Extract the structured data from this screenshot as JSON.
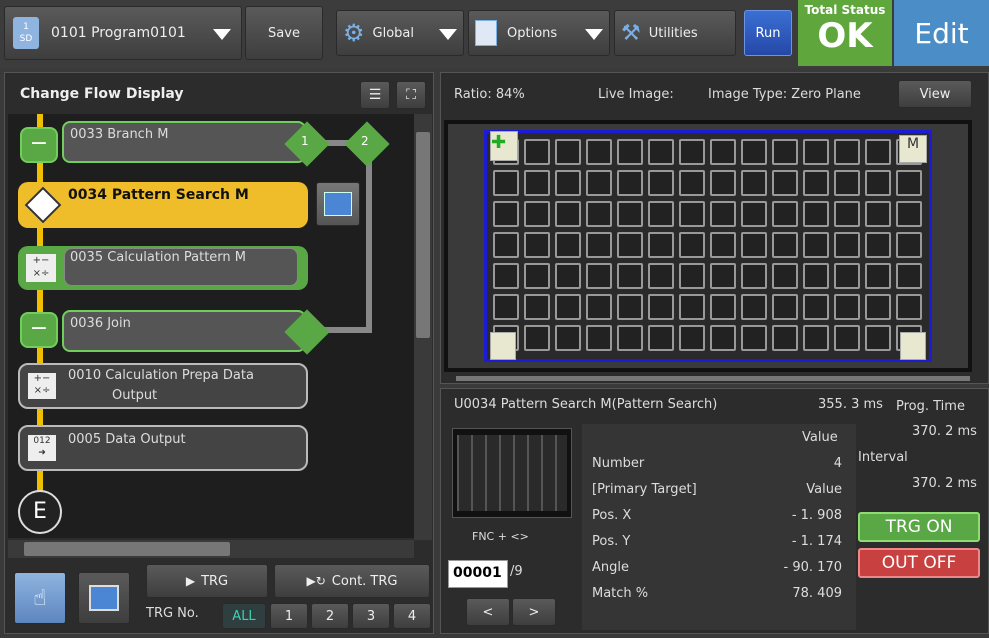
{
  "toolbar": {
    "program": "0101 Program0101",
    "sd_label": "SD",
    "sd_num": "1",
    "save": "Save",
    "global": "Global",
    "options": "Options",
    "utilities": "Utilities",
    "run": "Run",
    "total_status_label": "Total Status",
    "total_status_value": "OK",
    "edit": "Edit"
  },
  "flow": {
    "title": "Change Flow Display",
    "nodes": [
      {
        "label": "0033 Branch  M"
      },
      {
        "label": "0034  Pattern Search  M"
      },
      {
        "label": "0035 Calculation  Pattern  M"
      },
      {
        "label": "0036 Join"
      },
      {
        "label": "0010 Calculation  Prepa  Data"
      },
      {
        "label": "Output"
      },
      {
        "label": "0005 Data  Output"
      }
    ],
    "branch_1": "1",
    "branch_2": "2",
    "end": "E"
  },
  "trigger": {
    "trg": "TRG",
    "cont_trg": "Cont. TRG",
    "trg_no_label": "TRG  No.",
    "all": "ALL",
    "nums": [
      "1",
      "2",
      "3",
      "4"
    ]
  },
  "image_panel": {
    "ratio": "Ratio:  84%",
    "live": "Live  Image:",
    "type": "Image  Type:  Zero  Plane",
    "view": "View"
  },
  "result": {
    "header": "U0034  Pattern  Search  M(Pattern  Search)",
    "time_ms": "355. 3 ms",
    "prog_time_label": "Prog.  Time",
    "prog_time": "370. 2 ms",
    "interval_label": "Interval",
    "interval": "370. 2 ms",
    "value_header": "Value",
    "fnc": "FNC  +  <>",
    "page": "00001",
    "page_total": "/9",
    "prev": "<",
    "next": ">",
    "rows": [
      {
        "label": "Number",
        "value": "4"
      },
      {
        "label": "[Primary  Target]",
        "value": "Value"
      },
      {
        "label": "Pos.   X",
        "value": "- 1. 908"
      },
      {
        "label": "Pos.   Y",
        "value": "- 1. 174"
      },
      {
        "label": "Angle",
        "value": "- 90. 170"
      },
      {
        "label": "Match  %",
        "value": "78. 409"
      }
    ],
    "trg_on": "TRG ON",
    "out_off": "OUT OFF"
  }
}
